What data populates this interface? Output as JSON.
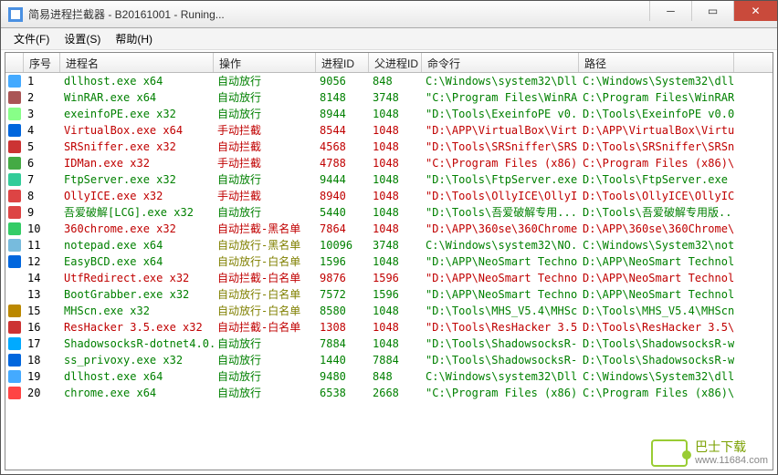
{
  "title": "简易进程拦截器 - B20161001 - Runing...",
  "menu": {
    "file": "文件(F)",
    "settings": "设置(S)",
    "help": "帮助(H)"
  },
  "headers": {
    "seq": "序号",
    "name": "进程名",
    "op": "操作",
    "pid": "进程ID",
    "ppid": "父进程ID",
    "cmd": "命令行",
    "path": "路径"
  },
  "rows": [
    {
      "seq": 1,
      "icon": "#4af",
      "name": "dllhost.exe x64",
      "op": "自动放行",
      "op_cls": "green",
      "row_cls": "green",
      "pid": 9056,
      "ppid": 848,
      "cmd": "C:\\Windows\\system32\\Dll...",
      "path": "C:\\Windows\\System32\\dll..."
    },
    {
      "seq": 2,
      "icon": "#a55",
      "name": "WinRAR.exe x64",
      "op": "自动放行",
      "op_cls": "green",
      "row_cls": "green",
      "pid": 8148,
      "ppid": 3748,
      "cmd": "\"C:\\Program Files\\WinRA...",
      "path": "C:\\Program Files\\WinRAR..."
    },
    {
      "seq": 3,
      "icon": "#8f8",
      "name": "exeinfoPE.exe x32",
      "op": "自动放行",
      "op_cls": "green",
      "row_cls": "green",
      "pid": 8944,
      "ppid": 1048,
      "cmd": "\"D:\\Tools\\ExeinfoPE v0...",
      "path": "D:\\Tools\\ExeinfoPE v0.0..."
    },
    {
      "seq": 4,
      "icon": "#06d",
      "name": "VirtualBox.exe x64",
      "op": "手动拦截",
      "op_cls": "red",
      "row_cls": "red",
      "pid": 8544,
      "ppid": 1048,
      "cmd": "\"D:\\APP\\VirtualBox\\Virt...",
      "path": "D:\\APP\\VirtualBox\\Virtu..."
    },
    {
      "seq": 5,
      "icon": "#c33",
      "name": "SRSniffer.exe x32",
      "op": "自动拦截",
      "op_cls": "red",
      "row_cls": "red",
      "pid": 4568,
      "ppid": 1048,
      "cmd": "\"D:\\Tools\\SRSniffer\\SRS...",
      "path": "D:\\Tools\\SRSniffer\\SRSn..."
    },
    {
      "seq": 6,
      "icon": "#4a4",
      "name": "IDMan.exe x32",
      "op": "手动拦截",
      "op_cls": "red",
      "row_cls": "red",
      "pid": 4788,
      "ppid": 1048,
      "cmd": "\"C:\\Program Files (x86)...",
      "path": "C:\\Program Files (x86)\\..."
    },
    {
      "seq": 7,
      "icon": "#3c9",
      "name": "FtpServer.exe x32",
      "op": "自动放行",
      "op_cls": "green",
      "row_cls": "green",
      "pid": 9444,
      "ppid": 1048,
      "cmd": "\"D:\\Tools\\FtpServer.exe\"",
      "path": "D:\\Tools\\FtpServer.exe"
    },
    {
      "seq": 8,
      "icon": "#d44",
      "name": "OllyICE.exe x32",
      "op": "手动拦截",
      "op_cls": "red",
      "row_cls": "red",
      "pid": 8940,
      "ppid": 1048,
      "cmd": "\"D:\\Tools\\OllyICE\\OllyI...",
      "path": "D:\\Tools\\OllyICE\\OllyIC..."
    },
    {
      "seq": 9,
      "icon": "#d44",
      "name": "吾爱破解[LCG].exe x32",
      "op": "自动放行",
      "op_cls": "green",
      "row_cls": "green",
      "pid": 5440,
      "ppid": 1048,
      "cmd": "\"D:\\Tools\\吾爱破解专用...",
      "path": "D:\\Tools\\吾爱破解专用版..."
    },
    {
      "seq": 10,
      "icon": "#3c6",
      "name": "360chrome.exe x32",
      "op": "自动拦截-黑名单",
      "op_cls": "red",
      "row_cls": "red",
      "pid": 7864,
      "ppid": 1048,
      "cmd": "\"D:\\APP\\360se\\360Chrome...",
      "path": "D:\\APP\\360se\\360Chrome\\..."
    },
    {
      "seq": 11,
      "icon": "#7bd",
      "name": "notepad.exe x64",
      "op": "自动放行-黑名单",
      "op_cls": "olive",
      "row_cls": "green",
      "pid": 10096,
      "ppid": 3748,
      "cmd": "C:\\Windows\\system32\\NO...",
      "path": "C:\\Windows\\System32\\not..."
    },
    {
      "seq": 12,
      "icon": "#06d",
      "name": "EasyBCD.exe x64",
      "op": "自动放行-白名单",
      "op_cls": "olive",
      "row_cls": "green",
      "pid": 1596,
      "ppid": 1048,
      "cmd": "\"D:\\APP\\NeoSmart Techno...",
      "path": "D:\\APP\\NeoSmart Technol..."
    },
    {
      "seq": 14,
      "icon": "#fff",
      "name": "UtfRedirect.exe x32",
      "op": "自动拦截-白名单",
      "op_cls": "red",
      "row_cls": "red",
      "pid": 9876,
      "ppid": 1596,
      "cmd": "\"D:\\APP\\NeoSmart Techno...",
      "path": "D:\\APP\\NeoSmart Technol..."
    },
    {
      "seq": 13,
      "icon": "#fff",
      "name": "BootGrabber.exe x32",
      "op": "自动放行-白名单",
      "op_cls": "olive",
      "row_cls": "green",
      "pid": 7572,
      "ppid": 1596,
      "cmd": "\"D:\\APP\\NeoSmart Techno...",
      "path": "D:\\APP\\NeoSmart Technol..."
    },
    {
      "seq": 15,
      "icon": "#b80",
      "name": "MHScn.exe x32",
      "op": "自动放行-白名单",
      "op_cls": "olive",
      "row_cls": "green",
      "pid": 8580,
      "ppid": 1048,
      "cmd": "\"D:\\Tools\\MHS_V5.4\\MHSc...",
      "path": "D:\\Tools\\MHS_V5.4\\MHScn..."
    },
    {
      "seq": 16,
      "icon": "#c33",
      "name": "ResHacker 3.5.exe x32",
      "op": "自动拦截-白名单",
      "op_cls": "red",
      "row_cls": "red",
      "pid": 1308,
      "ppid": 1048,
      "cmd": "\"D:\\Tools\\ResHacker 3.5...",
      "path": "D:\\Tools\\ResHacker 3.5\\..."
    },
    {
      "seq": 17,
      "icon": "#0af",
      "name": "ShadowsocksR-dotnet4.0...",
      "op": "自动放行",
      "op_cls": "green",
      "row_cls": "green",
      "pid": 7884,
      "ppid": 1048,
      "cmd": "\"D:\\Tools\\ShadowsocksR-...",
      "path": "D:\\Tools\\ShadowsocksR-w..."
    },
    {
      "seq": 18,
      "icon": "#06d",
      "name": "ss_privoxy.exe x32",
      "op": "自动放行",
      "op_cls": "green",
      "row_cls": "green",
      "pid": 1440,
      "ppid": 7884,
      "cmd": "\"D:\\Tools\\ShadowsocksR-...",
      "path": "D:\\Tools\\ShadowsocksR-w..."
    },
    {
      "seq": 19,
      "icon": "#4af",
      "name": "dllhost.exe x64",
      "op": "自动放行",
      "op_cls": "green",
      "row_cls": "green",
      "pid": 9480,
      "ppid": 848,
      "cmd": "C:\\Windows\\system32\\Dll...",
      "path": "C:\\Windows\\System32\\dll..."
    },
    {
      "seq": 20,
      "icon": "#f44",
      "name": "chrome.exe x64",
      "op": "自动放行",
      "op_cls": "green",
      "row_cls": "green",
      "pid": 6538,
      "ppid": 2668,
      "cmd": "\"C:\\Program Files (x86)...",
      "path": "C:\\Program Files (x86)\\..."
    }
  ],
  "watermark": {
    "brand": "巴士下载",
    "url": "www.11684.com"
  }
}
